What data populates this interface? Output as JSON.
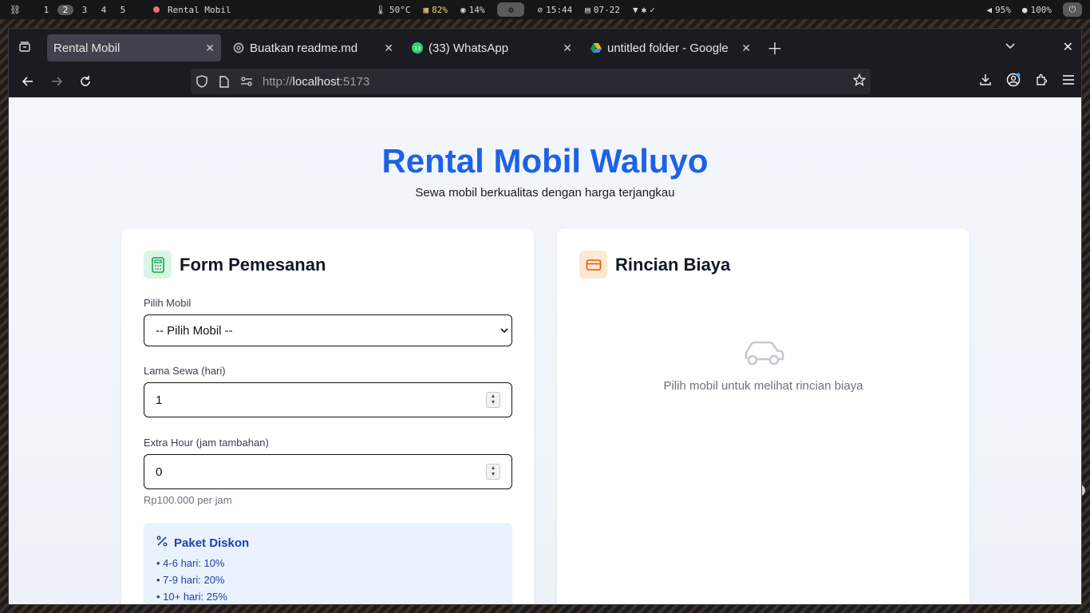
{
  "system_bar": {
    "workspaces": [
      "1",
      "2",
      "3",
      "4",
      "5"
    ],
    "active_workspace": "2",
    "app_title": "Rental Mobil",
    "temperature": "50°C",
    "battery_laptop": "82%",
    "cpu": "14%",
    "time": "15:44",
    "date": "07-22",
    "volume": "95%",
    "brightness": "100%"
  },
  "tabs": [
    {
      "title": "Rental Mobil",
      "active": true
    },
    {
      "title": "Buatkan readme.md",
      "active": false
    },
    {
      "title": "(33) WhatsApp",
      "active": false,
      "badge": "33"
    },
    {
      "title": "untitled folder - Google",
      "active": false
    }
  ],
  "url": {
    "scheme": "http://",
    "host": "localhost",
    "port": ":5173"
  },
  "page": {
    "title": "Rental Mobil Waluyo",
    "subtitle": "Sewa mobil berkualitas dengan harga terjangkau",
    "form": {
      "heading": "Form Pemesanan",
      "car_label": "Pilih Mobil",
      "car_selected": "-- Pilih Mobil --",
      "days_label": "Lama Sewa (hari)",
      "days_value": "1",
      "extra_label": "Extra Hour (jam tambahan)",
      "extra_value": "0",
      "extra_hint": "Rp100.000 per jam",
      "discount_heading": "Paket Diskon",
      "discounts": [
        "• 4-6 hari: 10%",
        "• 7-9 hari: 20%",
        "• 10+ hari: 25%"
      ]
    },
    "cost": {
      "heading": "Rincian Biaya",
      "empty_text": "Pilih mobil untuk melihat rincian biaya"
    }
  },
  "colors": {
    "brand_blue": "#1d62e6",
    "calc_green": "#16a34a",
    "card_orange": "#ea580c"
  }
}
